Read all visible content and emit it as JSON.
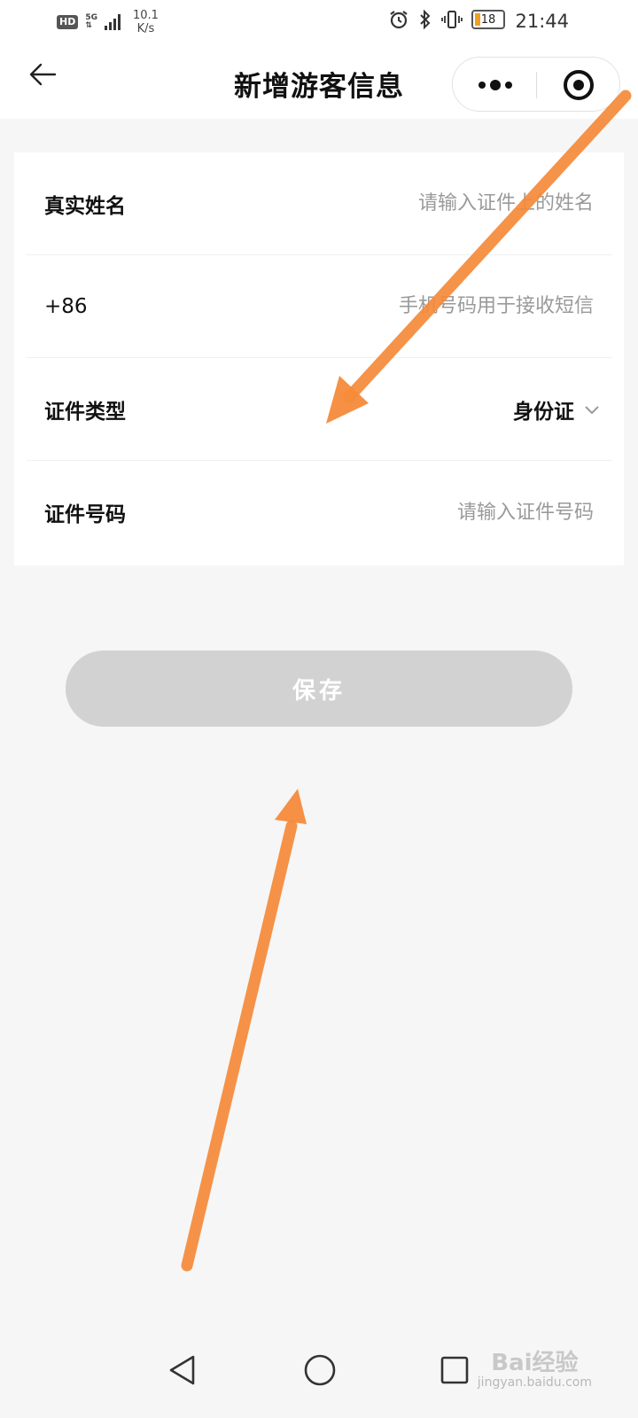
{
  "status_bar": {
    "hd": "HD",
    "network": "5G",
    "speed_value": "10.1",
    "speed_unit": "K/s",
    "battery_level": "18",
    "time": "21:44",
    "icons": [
      "alarm-icon",
      "bluetooth-icon",
      "vibrate-icon",
      "battery-icon"
    ]
  },
  "header": {
    "title": "新增游客信息",
    "back_icon": "arrow-left-icon",
    "more_icon": "more-dots-icon",
    "close_icon": "target-close-icon"
  },
  "form": {
    "name": {
      "label": "真实姓名",
      "placeholder": "请输入证件上的姓名",
      "value": ""
    },
    "phone": {
      "prefix": "+86",
      "placeholder": "手机号码用于接收短信",
      "value": ""
    },
    "id_type": {
      "label": "证件类型",
      "value": "身份证",
      "icon": "chevron-down-icon"
    },
    "id_number": {
      "label": "证件号码",
      "placeholder": "请输入证件号码",
      "value": ""
    }
  },
  "actions": {
    "save_label": "保存"
  },
  "annotations": {
    "arrow_color": "#f58a3a"
  },
  "navigation": {
    "back_icon": "triangle-back-icon",
    "home_icon": "circle-home-icon",
    "recent_icon": "square-recent-icon"
  },
  "watermark": {
    "brand": "Bai经验",
    "url": "jingyan.baidu.com"
  },
  "colors": {
    "background": "#f6f6f6",
    "card": "#ffffff",
    "save_disabled": "#d2d2d2",
    "placeholder": "#9a9a9a"
  }
}
